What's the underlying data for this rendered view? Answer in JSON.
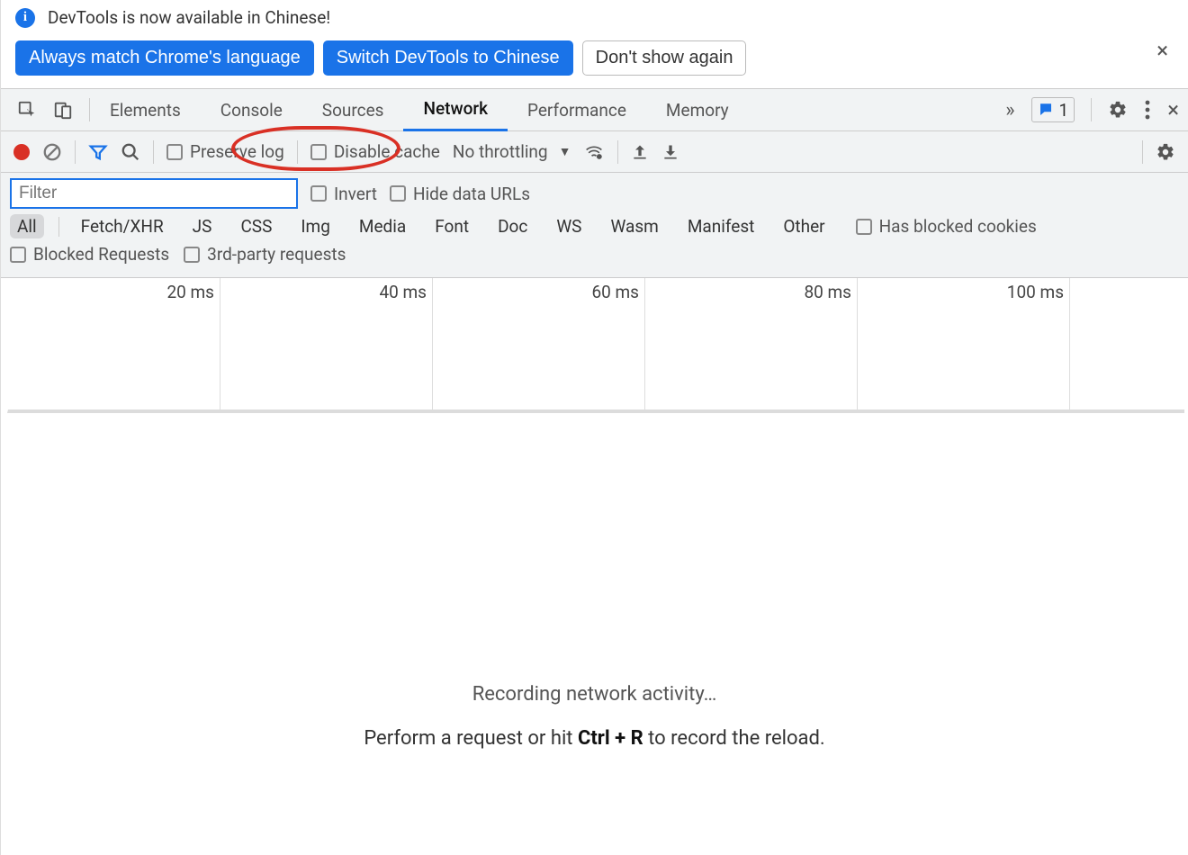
{
  "infobar": {
    "message": "DevTools is now available in Chinese!",
    "buttons": {
      "match": "Always match Chrome's language",
      "switch": "Switch DevTools to Chinese",
      "dismiss": "Don't show again"
    }
  },
  "tabs": {
    "elements": "Elements",
    "console": "Console",
    "sources": "Sources",
    "network": "Network",
    "performance": "Performance",
    "memory": "Memory",
    "issues_count": "1"
  },
  "toolbar": {
    "preserve_log": "Preserve log",
    "disable_cache": "Disable cache",
    "throttling": "No throttling"
  },
  "filter": {
    "placeholder": "Filter",
    "invert": "Invert",
    "hide_data_urls": "Hide data URLs",
    "types": [
      "All",
      "Fetch/XHR",
      "JS",
      "CSS",
      "Img",
      "Media",
      "Font",
      "Doc",
      "WS",
      "Wasm",
      "Manifest",
      "Other"
    ],
    "has_blocked_cookies": "Has blocked cookies",
    "blocked_requests": "Blocked Requests",
    "third_party": "3rd-party requests"
  },
  "timeline": {
    "ticks": [
      "20 ms",
      "40 ms",
      "60 ms",
      "80 ms",
      "100 ms"
    ]
  },
  "empty": {
    "title": "Recording network activity…",
    "line2_a": "Perform a request or hit ",
    "kbd": "Ctrl + R",
    "line2_b": " to record the reload."
  },
  "annotation": {
    "circle_target": "preserve_log"
  }
}
